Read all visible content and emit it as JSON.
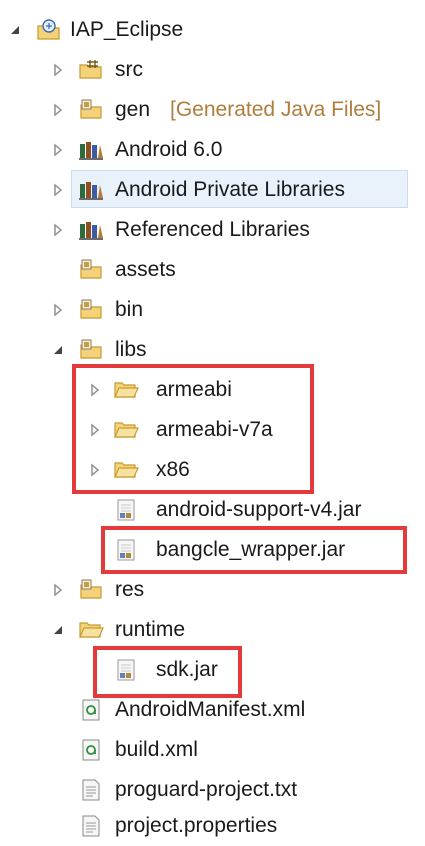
{
  "tree": {
    "project": {
      "label": "IAP_Eclipse"
    },
    "items": [
      {
        "id": "src",
        "label": "src"
      },
      {
        "id": "gen",
        "label": "gen",
        "decoration": "[Generated Java Files]"
      },
      {
        "id": "android",
        "label": "Android 6.0"
      },
      {
        "id": "private_libs",
        "label": "Android Private Libraries"
      },
      {
        "id": "ref_libs",
        "label": "Referenced Libraries"
      },
      {
        "id": "assets",
        "label": "assets"
      },
      {
        "id": "bin",
        "label": "bin"
      },
      {
        "id": "libs",
        "label": "libs"
      },
      {
        "id": "armeabi",
        "label": "armeabi"
      },
      {
        "id": "armeabi_v7a",
        "label": "armeabi-v7a"
      },
      {
        "id": "x86",
        "label": "x86"
      },
      {
        "id": "support_jar",
        "label": "android-support-v4.jar"
      },
      {
        "id": "bangcle_jar",
        "label": "bangcle_wrapper.jar"
      },
      {
        "id": "res",
        "label": "res"
      },
      {
        "id": "runtime",
        "label": "runtime"
      },
      {
        "id": "sdk_jar",
        "label": "sdk.jar"
      },
      {
        "id": "manifest",
        "label": "AndroidManifest.xml"
      },
      {
        "id": "build_xml",
        "label": "build.xml"
      },
      {
        "id": "proguard",
        "label": "proguard-project.txt"
      },
      {
        "id": "properties",
        "label": "project.properties"
      }
    ]
  },
  "colors": {
    "highlight_box": "#e33b3b",
    "selection_bg": "#e9f1fb",
    "decoration_text": "#b07d3c",
    "folder_fill": "#f3d27a"
  },
  "icons": {
    "project": "java-project-icon",
    "package_folder": "package-folder-icon",
    "library": "library-icon",
    "folder": "folder-icon",
    "jar": "jar-file-icon",
    "xml": "xml-file-icon",
    "text": "text-file-icon"
  }
}
